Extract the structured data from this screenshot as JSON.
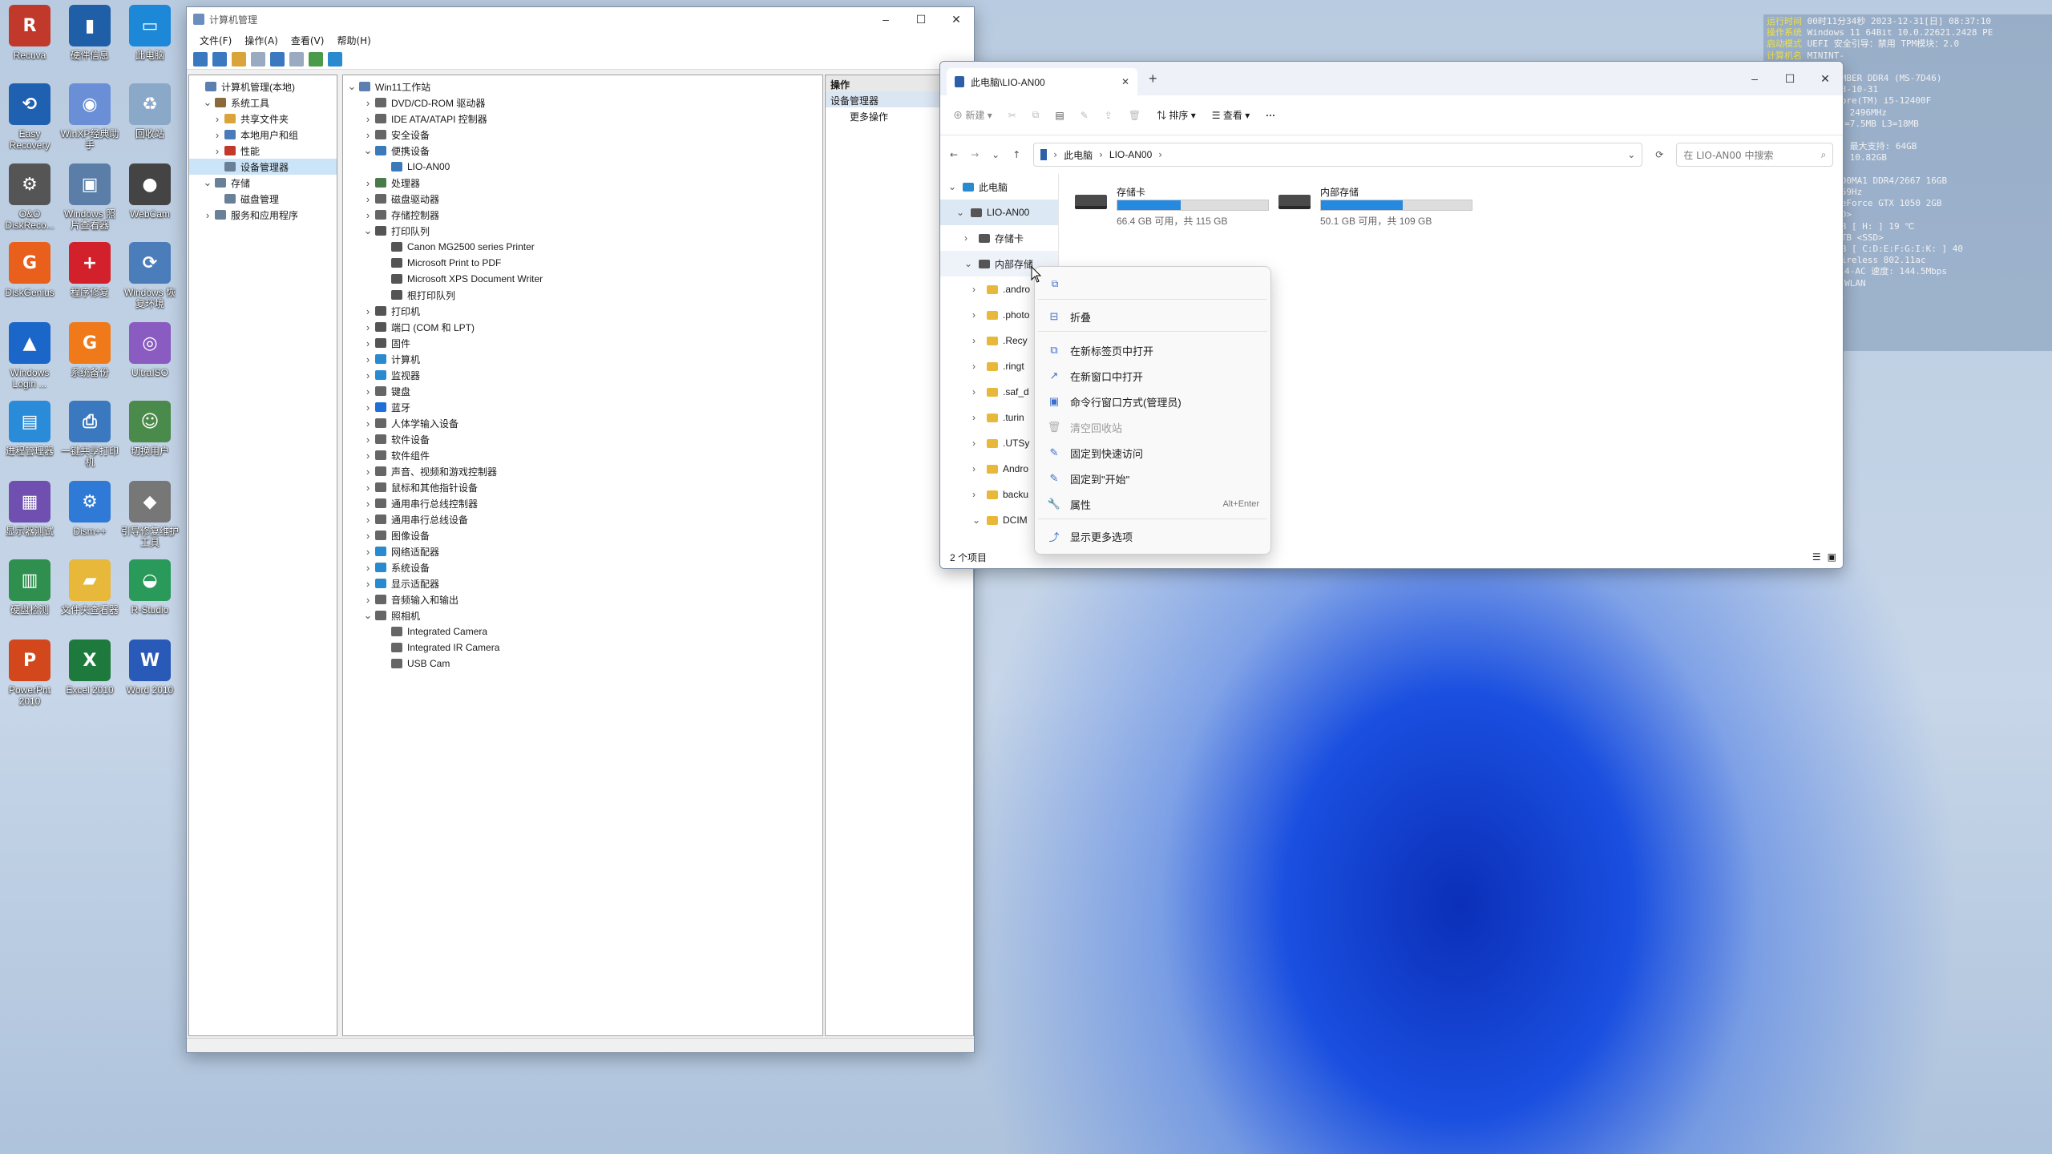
{
  "desktop": {
    "icons": [
      {
        "label": "Recuva",
        "color": "#c0392b",
        "glyph": "R"
      },
      {
        "label": "硬件信息",
        "color": "#1f5fa8",
        "glyph": "▮"
      },
      {
        "label": "此电脑",
        "color": "#1e88d8",
        "glyph": "▭"
      },
      {
        "label": "Easy Recovery",
        "color": "#2060b0",
        "glyph": "⟲"
      },
      {
        "label": "WinXP经典助手",
        "color": "#6a8fd6",
        "glyph": "◉"
      },
      {
        "label": "回收站",
        "color": "#8aa8c8",
        "glyph": "♻"
      },
      {
        "label": "O&O DiskReco...",
        "color": "#555",
        "glyph": "⚙"
      },
      {
        "label": "Windows 照片查看器",
        "color": "#5a7ea8",
        "glyph": "▣"
      },
      {
        "label": "WebCam",
        "color": "#444",
        "glyph": "●"
      },
      {
        "label": "DiskGenius",
        "color": "#e8601c",
        "glyph": "G"
      },
      {
        "label": "程序修复",
        "color": "#d3212b",
        "glyph": "+"
      },
      {
        "label": "Windows 恢复环境",
        "color": "#4b7dbb",
        "glyph": "⟳"
      },
      {
        "label": "Windows Login ...",
        "color": "#1b66c9",
        "glyph": "▲"
      },
      {
        "label": "系统备份",
        "color": "#f07a1a",
        "glyph": "G"
      },
      {
        "label": "UltraISO",
        "color": "#8a5bc0",
        "glyph": "◎"
      },
      {
        "label": "进程管理器",
        "color": "#2a8bd8",
        "glyph": "▤"
      },
      {
        "label": "一键共享打印机",
        "color": "#3a78c0",
        "glyph": "⎙"
      },
      {
        "label": "切换用户",
        "color": "#4a8a4a",
        "glyph": "☺"
      },
      {
        "label": "显示器测试",
        "color": "#6f4fb0",
        "glyph": "▦"
      },
      {
        "label": "Dism++",
        "color": "#2f7ad6",
        "glyph": "⚙"
      },
      {
        "label": "引导修复维护工具",
        "color": "#777",
        "glyph": "◆"
      },
      {
        "label": "硬盘检测",
        "color": "#2f8f4f",
        "glyph": "▥"
      },
      {
        "label": "文件夹查看器",
        "color": "#e8b83a",
        "glyph": "▰"
      },
      {
        "label": "R-Studio",
        "color": "#2a9a5a",
        "glyph": "◒"
      },
      {
        "label": "PowerPnt 2010",
        "color": "#d2471c",
        "glyph": "P"
      },
      {
        "label": "Excel 2010",
        "color": "#1e7a3c",
        "glyph": "X"
      },
      {
        "label": "Word 2010",
        "color": "#2a5ab8",
        "glyph": "W"
      }
    ]
  },
  "sysinfo": [
    {
      "k": "运行时间",
      "v": "00时11分34秒 2023-12-31[日] 08:37:10"
    },
    {
      "k": "操作系统",
      "v": "Windows 11 64Bit 10.0.22621.2428 PE"
    },
    {
      "k": "启动模式",
      "v": "UEFI   安全引导：禁用   TPM模块：2.0"
    },
    {
      "k": "计算机名",
      "v": "MININT-"
    },
    {
      "k": "",
      "v": "12_M51E008302"
    },
    {
      "k": "",
      "v": "-Star B660M BOMBER DDR4 (MS-7D46)"
    },
    {
      "k": "",
      "v": "2.F0  Date: 2023-10-31"
    },
    {
      "k": "",
      "v": "Gen Intel(R) Core(TM) i5-12400F"
    },
    {
      "k": "",
      "v": "6  线程: 12     主频: 2496MHz"
    },
    {
      "k": "",
      "v": "存: L1=480KB L2=7.5MB L3=18MB"
    },
    {
      "k": "",
      "v": "：0 %"
    },
    {
      "k": "",
      "v": "：16GB 插槽数: 2 最大支持: 64GB"
    },
    {
      "k": "",
      "v": "：5.18GB        可使用: 10.82GB"
    },
    {
      "k": "",
      "v": "：32.4 %"
    },
    {
      "k": "",
      "v": "C HKED4161DAA1D0MA1 DDR4/2667 16GB"
    },
    {
      "k": "",
      "v": "DMI 2560x1440 59Hz"
    },
    {
      "k": "",
      "v": "VIDIA Vulkan GeForce GTX 1050 2GB"
    },
    {
      "k": "",
      "v": "128GSSD340 <SSD>"
    },
    {
      "k": "",
      "v": "TA MBR 119.24GB [ H: ] 19 ℃"
    },
    {
      "k": "",
      "v": "2 SATA M1912-1TB <SSD>"
    },
    {
      "k": "",
      "v": "TA GPT 953.87GB [ C:D:E:F:G:I:K: ] 40"
    },
    {
      "k": "",
      "v": "altek 8812BU Wireless 802.11ac"
    },
    {
      "k": "",
      "v": "：8C-88-2B-00-14-AC 速度: 144.5Mbps"
    },
    {
      "k": "",
      "v": "：192.168.1.87 WLAN"
    },
    {
      "k": "",
      "v": "关: 192.168.1.1"
    },
    {
      "k": "",
      "v": " 0 K/s          0.1 K/s"
    }
  ],
  "cm": {
    "title": "计算机管理",
    "menu": [
      "文件(F)",
      "操作(A)",
      "查看(V)",
      "帮助(H)"
    ],
    "left": [
      {
        "t": "计算机管理(本地)",
        "lvl": 0,
        "tw": "",
        "c": "#5a7fb0"
      },
      {
        "t": "系统工具",
        "lvl": 1,
        "tw": "v",
        "c": "#8a6a3a"
      },
      {
        "t": "共享文件夹",
        "lvl": 2,
        "tw": ">",
        "c": "#d9a53a"
      },
      {
        "t": "本地用户和组",
        "lvl": 2,
        "tw": ">",
        "c": "#4a7ab8"
      },
      {
        "t": "性能",
        "lvl": 2,
        "tw": ">",
        "c": "#c0392b"
      },
      {
        "t": "设备管理器",
        "lvl": 2,
        "tw": "",
        "c": "#6a7f98",
        "sel": true
      },
      {
        "t": "存储",
        "lvl": 1,
        "tw": "v",
        "c": "#6a7f98"
      },
      {
        "t": "磁盘管理",
        "lvl": 2,
        "tw": "",
        "c": "#6a7f98"
      },
      {
        "t": "服务和应用程序",
        "lvl": 1,
        "tw": ">",
        "c": "#6a7f98"
      }
    ],
    "devices": [
      {
        "t": "Win11工作站",
        "lvl": 0,
        "tw": "v",
        "c": "#5a7fb0"
      },
      {
        "t": "DVD/CD-ROM 驱动器",
        "lvl": 1,
        "tw": ">",
        "c": "#666"
      },
      {
        "t": "IDE ATA/ATAPI 控制器",
        "lvl": 1,
        "tw": ">",
        "c": "#666"
      },
      {
        "t": "安全设备",
        "lvl": 1,
        "tw": ">",
        "c": "#666"
      },
      {
        "t": "便携设备",
        "lvl": 1,
        "tw": "v",
        "c": "#3a7ab8"
      },
      {
        "t": "LIO-AN00",
        "lvl": 2,
        "tw": "",
        "c": "#3a7ab8"
      },
      {
        "t": "处理器",
        "lvl": 1,
        "tw": ">",
        "c": "#4a7a4a"
      },
      {
        "t": "磁盘驱动器",
        "lvl": 1,
        "tw": ">",
        "c": "#666"
      },
      {
        "t": "存储控制器",
        "lvl": 1,
        "tw": ">",
        "c": "#666"
      },
      {
        "t": "打印队列",
        "lvl": 1,
        "tw": "v",
        "c": "#555"
      },
      {
        "t": "Canon MG2500 series Printer",
        "lvl": 2,
        "tw": "",
        "c": "#555"
      },
      {
        "t": "Microsoft Print to PDF",
        "lvl": 2,
        "tw": "",
        "c": "#555"
      },
      {
        "t": "Microsoft XPS Document Writer",
        "lvl": 2,
        "tw": "",
        "c": "#555"
      },
      {
        "t": "根打印队列",
        "lvl": 2,
        "tw": "",
        "c": "#555"
      },
      {
        "t": "打印机",
        "lvl": 1,
        "tw": ">",
        "c": "#555"
      },
      {
        "t": "端口 (COM 和 LPT)",
        "lvl": 1,
        "tw": ">",
        "c": "#555"
      },
      {
        "t": "固件",
        "lvl": 1,
        "tw": ">",
        "c": "#555"
      },
      {
        "t": "计算机",
        "lvl": 1,
        "tw": ">",
        "c": "#2a8ad0"
      },
      {
        "t": "监视器",
        "lvl": 1,
        "tw": ">",
        "c": "#2a8ad0"
      },
      {
        "t": "键盘",
        "lvl": 1,
        "tw": ">",
        "c": "#666"
      },
      {
        "t": "蓝牙",
        "lvl": 1,
        "tw": ">",
        "c": "#1e6fd8"
      },
      {
        "t": "人体学输入设备",
        "lvl": 1,
        "tw": ">",
        "c": "#666"
      },
      {
        "t": "软件设备",
        "lvl": 1,
        "tw": ">",
        "c": "#666"
      },
      {
        "t": "软件组件",
        "lvl": 1,
        "tw": ">",
        "c": "#666"
      },
      {
        "t": "声音、视频和游戏控制器",
        "lvl": 1,
        "tw": ">",
        "c": "#666"
      },
      {
        "t": "鼠标和其他指针设备",
        "lvl": 1,
        "tw": ">",
        "c": "#666"
      },
      {
        "t": "通用串行总线控制器",
        "lvl": 1,
        "tw": ">",
        "c": "#666"
      },
      {
        "t": "通用串行总线设备",
        "lvl": 1,
        "tw": ">",
        "c": "#666"
      },
      {
        "t": "图像设备",
        "lvl": 1,
        "tw": ">",
        "c": "#666"
      },
      {
        "t": "网络适配器",
        "lvl": 1,
        "tw": ">",
        "c": "#2a8ad0"
      },
      {
        "t": "系统设备",
        "lvl": 1,
        "tw": ">",
        "c": "#2a8ad0"
      },
      {
        "t": "显示适配器",
        "lvl": 1,
        "tw": ">",
        "c": "#2a8ad0"
      },
      {
        "t": "音频输入和输出",
        "lvl": 1,
        "tw": ">",
        "c": "#666"
      },
      {
        "t": "照相机",
        "lvl": 1,
        "tw": "v",
        "c": "#666"
      },
      {
        "t": "Integrated Camera",
        "lvl": 2,
        "tw": "",
        "c": "#666"
      },
      {
        "t": "Integrated IR Camera",
        "lvl": 2,
        "tw": "",
        "c": "#666"
      },
      {
        "t": "USB Cam",
        "lvl": 2,
        "tw": "",
        "c": "#666"
      }
    ],
    "actions_header": "操作",
    "actions_sub": "设备管理器",
    "actions_more": "更多操作"
  },
  "ex": {
    "tab_title": "此电脑\\LIO-AN00",
    "toolbar": {
      "new": "新建",
      "sort": "排序",
      "view": "查看",
      "more": "···"
    },
    "crumbs": [
      "此电脑",
      "LIO-AN00"
    ],
    "search_placeholder": "在 LIO-AN00 中搜索",
    "nav": [
      {
        "t": "此电脑",
        "tw": "v",
        "lvl": 0
      },
      {
        "t": "LIO-AN00",
        "tw": "v",
        "lvl": 1,
        "sel": true
      },
      {
        "t": "存储卡",
        "tw": ">",
        "lvl": 2
      },
      {
        "t": "内部存储",
        "tw": "v",
        "lvl": 2,
        "hov": true
      },
      {
        "t": ".andro",
        "tw": ">",
        "lvl": 3
      },
      {
        "t": ".photo",
        "tw": ">",
        "lvl": 3
      },
      {
        "t": ".Recy",
        "tw": ">",
        "lvl": 3
      },
      {
        "t": ".ringt",
        "tw": ">",
        "lvl": 3
      },
      {
        "t": ".saf_d",
        "tw": ">",
        "lvl": 3
      },
      {
        "t": ".turin",
        "tw": ">",
        "lvl": 3
      },
      {
        "t": ".UTSy",
        "tw": ">",
        "lvl": 3
      },
      {
        "t": "Andro",
        "tw": ">",
        "lvl": 3
      },
      {
        "t": "backu",
        "tw": ">",
        "lvl": 3
      },
      {
        "t": "DCIM",
        "tw": "v",
        "lvl": 3
      }
    ],
    "drives": [
      {
        "name": "存储卡",
        "info": "66.4 GB 可用，共 115 GB",
        "used": 0.42
      },
      {
        "name": "内部存储",
        "info": "50.1 GB 可用，共 109 GB",
        "used": 0.54
      }
    ],
    "status": "2 个项目"
  },
  "ctx": {
    "items": [
      {
        "t": "折叠",
        "icon": "⊟",
        "dis": false
      },
      {
        "t": "在新标签页中打开",
        "icon": "⧉",
        "dis": false
      },
      {
        "t": "在新窗口中打开",
        "icon": "↗",
        "dis": false
      },
      {
        "t": "命令行窗口方式(管理员)",
        "icon": "▣",
        "dis": false
      },
      {
        "t": "清空回收站",
        "icon": "🗑",
        "dis": true
      },
      {
        "t": "固定到快速访问",
        "icon": "✎",
        "dis": false
      },
      {
        "t": "固定到\"开始\"",
        "icon": "✎",
        "dis": false
      },
      {
        "t": "属性",
        "icon": "🔧",
        "dis": false,
        "shortcut": "Alt+Enter"
      },
      {
        "t": "显示更多选项",
        "icon": "⤴",
        "dis": false
      }
    ]
  },
  "colors": {
    "accent": "#2689e0",
    "select": "#cce4f7"
  }
}
